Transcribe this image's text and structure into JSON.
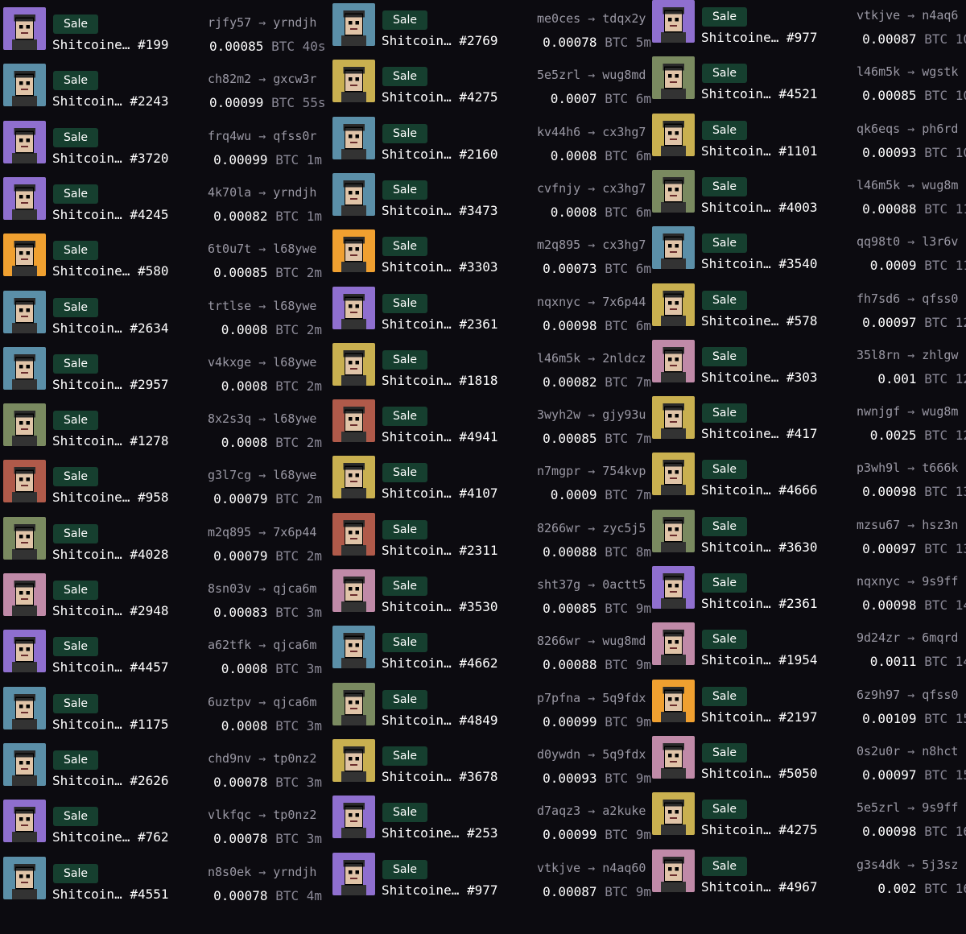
{
  "sale_label": "Sale",
  "currency": "BTC",
  "arrow": "→",
  "columns": [
    {
      "items": [
        {
          "name": "Shitcoine… #199",
          "from": "rjfy57",
          "to": "yrndjh",
          "price": "0.00085",
          "time": "40s",
          "bg": "#8f6fcf"
        },
        {
          "name": "Shitcoin… #2243",
          "from": "ch82m2",
          "to": "gxcw3r",
          "price": "0.00099",
          "time": "55s",
          "bg": "#5b8fa8"
        },
        {
          "name": "Shitcoin… #3720",
          "from": "frq4wu",
          "to": "qfss0r",
          "price": "0.00099",
          "time": "1m",
          "bg": "#8f6fcf"
        },
        {
          "name": "Shitcoin… #4245",
          "from": "4k70la",
          "to": "yrndjh",
          "price": "0.00082",
          "time": "1m",
          "bg": "#8f6fcf"
        },
        {
          "name": "Shitcoine… #580",
          "from": "6t0u7t",
          "to": "l68ywe",
          "price": "0.00085",
          "time": "2m",
          "bg": "#f0a030"
        },
        {
          "name": "Shitcoin… #2634",
          "from": "trtlse",
          "to": "l68ywe",
          "price": "0.0008",
          "time": "2m",
          "bg": "#5b8fa8"
        },
        {
          "name": "Shitcoin… #2957",
          "from": "v4kxge",
          "to": "l68ywe",
          "price": "0.0008",
          "time": "2m",
          "bg": "#5b8fa8"
        },
        {
          "name": "Shitcoin… #1278",
          "from": "8x2s3q",
          "to": "l68ywe",
          "price": "0.0008",
          "time": "2m",
          "bg": "#7a8a60"
        },
        {
          "name": "Shitcoine… #958",
          "from": "g3l7cg",
          "to": "l68ywe",
          "price": "0.00079",
          "time": "2m",
          "bg": "#b05a4a"
        },
        {
          "name": "Shitcoin… #4028",
          "from": "m2q895",
          "to": "7x6p44",
          "price": "0.00079",
          "time": "2m",
          "bg": "#7a8a60"
        },
        {
          "name": "Shitcoin… #2948",
          "from": "8sn03v",
          "to": "qjca6m",
          "price": "0.00083",
          "time": "3m",
          "bg": "#c08aa8"
        },
        {
          "name": "Shitcoin… #4457",
          "from": "a62tfk",
          "to": "qjca6m",
          "price": "0.0008",
          "time": "3m",
          "bg": "#8f6fcf"
        },
        {
          "name": "Shitcoin… #1175",
          "from": "6uztpv",
          "to": "qjca6m",
          "price": "0.0008",
          "time": "3m",
          "bg": "#5b8fa8"
        },
        {
          "name": "Shitcoin… #2626",
          "from": "chd9nv",
          "to": "tp0nz2",
          "price": "0.00078",
          "time": "3m",
          "bg": "#5b8fa8"
        },
        {
          "name": "Shitcoine… #762",
          "from": "vlkfqc",
          "to": "tp0nz2",
          "price": "0.00078",
          "time": "3m",
          "bg": "#8f6fcf"
        },
        {
          "name": "Shitcoin… #4551",
          "from": "n8s0ek",
          "to": "yrndjh",
          "price": "0.00078",
          "time": "4m",
          "bg": "#5b8fa8"
        }
      ]
    },
    {
      "items": [
        {
          "name": "Shitcoin… #2769",
          "from": "me0ces",
          "to": "tdqx2y",
          "price": "0.00078",
          "time": "5m",
          "bg": "#5b8fa8"
        },
        {
          "name": "Shitcoin… #4275",
          "from": "5e5zrl",
          "to": "wug8md",
          "price": "0.0007",
          "time": "6m",
          "bg": "#c9b050"
        },
        {
          "name": "Shitcoin… #2160",
          "from": "kv44h6",
          "to": "cx3hg7",
          "price": "0.0008",
          "time": "6m",
          "bg": "#5b8fa8"
        },
        {
          "name": "Shitcoin… #3473",
          "from": "cvfnjy",
          "to": "cx3hg7",
          "price": "0.0008",
          "time": "6m",
          "bg": "#5b8fa8"
        },
        {
          "name": "Shitcoin… #3303",
          "from": "m2q895",
          "to": "cx3hg7",
          "price": "0.00073",
          "time": "6m",
          "bg": "#f0a030"
        },
        {
          "name": "Shitcoin… #2361",
          "from": "nqxnyc",
          "to": "7x6p44",
          "price": "0.00098",
          "time": "6m",
          "bg": "#8f6fcf"
        },
        {
          "name": "Shitcoin… #1818",
          "from": "l46m5k",
          "to": "2nldcz",
          "price": "0.00082",
          "time": "7m",
          "bg": "#c9b050"
        },
        {
          "name": "Shitcoin… #4941",
          "from": "3wyh2w",
          "to": "gjy93u",
          "price": "0.00085",
          "time": "7m",
          "bg": "#b05a4a"
        },
        {
          "name": "Shitcoin… #4107",
          "from": "n7mgpr",
          "to": "754kvp",
          "price": "0.0009",
          "time": "7m",
          "bg": "#c9b050"
        },
        {
          "name": "Shitcoin… #2311",
          "from": "8266wr",
          "to": "zyc5j5",
          "price": "0.00088",
          "time": "8m",
          "bg": "#b05a4a"
        },
        {
          "name": "Shitcoin… #3530",
          "from": "sht37g",
          "to": "0actt5",
          "price": "0.00085",
          "time": "9m",
          "bg": "#c08aa8"
        },
        {
          "name": "Shitcoin… #4662",
          "from": "8266wr",
          "to": "wug8md",
          "price": "0.00088",
          "time": "9m",
          "bg": "#5b8fa8"
        },
        {
          "name": "Shitcoin… #4849",
          "from": "p7pfna",
          "to": "5q9fdx",
          "price": "0.00099",
          "time": "9m",
          "bg": "#7a8a60"
        },
        {
          "name": "Shitcoin… #3678",
          "from": "d0ywdn",
          "to": "5q9fdx",
          "price": "0.00093",
          "time": "9m",
          "bg": "#c9b050"
        },
        {
          "name": "Shitcoine… #253",
          "from": "d7aqz3",
          "to": "a2kuke",
          "price": "0.00099",
          "time": "9m",
          "bg": "#8f6fcf"
        },
        {
          "name": "Shitcoine… #977",
          "from": "vtkjve",
          "to": "n4aq60",
          "price": "0.00087",
          "time": "9m",
          "bg": "#8f6fcf"
        }
      ]
    },
    {
      "items": [
        {
          "name": "Shitcoine… #977",
          "from": "vtkjve",
          "to": "n4aq6",
          "price": "0.00087",
          "time": "10",
          "bg": "#8f6fcf"
        },
        {
          "name": "Shitcoin… #4521",
          "from": "l46m5k",
          "to": "wgstk",
          "price": "0.00085",
          "time": "10",
          "bg": "#7a8a60"
        },
        {
          "name": "Shitcoin… #1101",
          "from": "qk6eqs",
          "to": "ph6rd",
          "price": "0.00093",
          "time": "10",
          "bg": "#c9b050"
        },
        {
          "name": "Shitcoin… #4003",
          "from": "l46m5k",
          "to": "wug8m",
          "price": "0.00088",
          "time": "11",
          "bg": "#7a8a60"
        },
        {
          "name": "Shitcoin… #3540",
          "from": "qq98t0",
          "to": "l3r6v",
          "price": "0.0009",
          "time": "11",
          "bg": "#5b8fa8"
        },
        {
          "name": "Shitcoine… #578",
          "from": "fh7sd6",
          "to": "qfss0",
          "price": "0.00097",
          "time": "12",
          "bg": "#c9b050"
        },
        {
          "name": "Shitcoine… #303",
          "from": "35l8rn",
          "to": "zhlgw",
          "price": "0.001",
          "time": "12",
          "bg": "#c08aa8"
        },
        {
          "name": "Shitcoine… #417",
          "from": "nwnjgf",
          "to": "wug8m",
          "price": "0.0025",
          "time": "12",
          "bg": "#c9b050"
        },
        {
          "name": "Shitcoin… #4666",
          "from": "p3wh9l",
          "to": "t666k",
          "price": "0.00098",
          "time": "13",
          "bg": "#c9b050"
        },
        {
          "name": "Shitcoin… #3630",
          "from": "mzsu67",
          "to": "hsz3n",
          "price": "0.00097",
          "time": "13",
          "bg": "#7a8a60"
        },
        {
          "name": "Shitcoin… #2361",
          "from": "nqxnyc",
          "to": "9s9ff",
          "price": "0.00098",
          "time": "14",
          "bg": "#8f6fcf"
        },
        {
          "name": "Shitcoin… #1954",
          "from": "9d24zr",
          "to": "6mqrd",
          "price": "0.0011",
          "time": "14",
          "bg": "#c08aa8"
        },
        {
          "name": "Shitcoin… #2197",
          "from": "6z9h97",
          "to": "qfss0",
          "price": "0.00109",
          "time": "15",
          "bg": "#f0a030"
        },
        {
          "name": "Shitcoin… #5050",
          "from": "0s2u0r",
          "to": "n8hct",
          "price": "0.00097",
          "time": "15",
          "bg": "#c08aa8"
        },
        {
          "name": "Shitcoin… #4275",
          "from": "5e5zrl",
          "to": "9s9ff",
          "price": "0.00098",
          "time": "16",
          "bg": "#c9b050"
        },
        {
          "name": "Shitcoin… #4967",
          "from": "g3s4dk",
          "to": "5j3sz",
          "price": "0.002",
          "time": "16",
          "bg": "#c08aa8"
        }
      ]
    }
  ]
}
